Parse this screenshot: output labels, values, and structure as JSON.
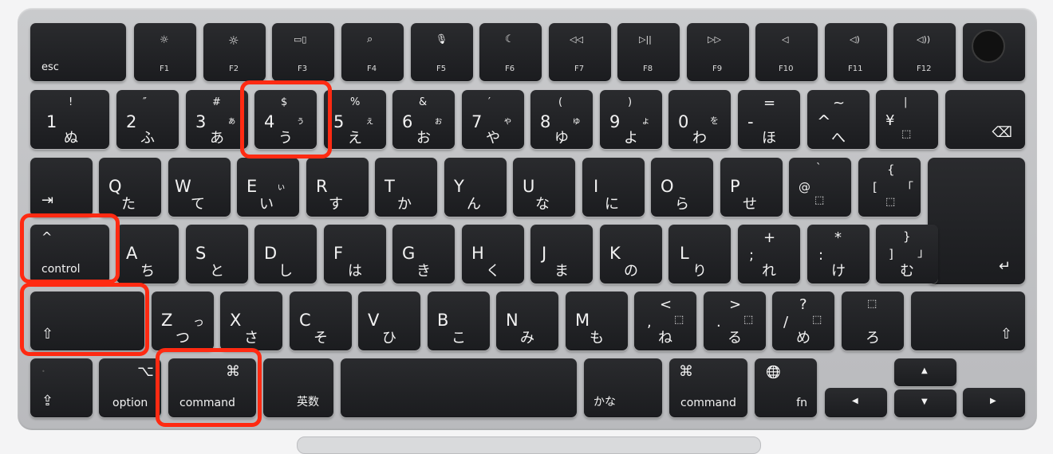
{
  "keyboard": {
    "esc": "esc",
    "brightness_down_icon": "☼",
    "brightness_up_icon": "☼",
    "mission_icon": "▭▯",
    "search_icon": "⌕",
    "mic_icon": "🎙",
    "moon_icon": "☾",
    "rewind_icon": "◁◁",
    "play_icon": "▷||",
    "ffwd_icon": "▷▷",
    "mute_icon": "◁",
    "vol_down_icon": "◁)",
    "vol_up_icon": "◁))",
    "f1": "F1",
    "f2": "F2",
    "f3": "F3",
    "f4": "F4",
    "f5": "F5",
    "f6": "F6",
    "f7": "F7",
    "f8": "F8",
    "f9": "F9",
    "f10": "F10",
    "f11": "F11",
    "f12": "F12",
    "n1": "1",
    "n1s": "!",
    "n1k": "ぬ",
    "n2": "2",
    "n2s": "″",
    "n2k": "ふ",
    "n3": "3",
    "n3s": "#",
    "n3k": "あ",
    "n3ks": "ぁ",
    "n4": "4",
    "n4s": "$",
    "n4k": "う",
    "n4ks": "ぅ",
    "n5": "5",
    "n5s": "%",
    "n5k": "え",
    "n5ks": "ぇ",
    "n6": "6",
    "n6s": "&",
    "n6k": "お",
    "n6ks": "ぉ",
    "n7": "7",
    "n7s": "′",
    "n7k": "や",
    "n7ks": "ゃ",
    "n8": "8",
    "n8s": "(",
    "n8k": "ゆ",
    "n8ks": "ゅ",
    "n9": "9",
    "n9s": ")",
    "n9k": "よ",
    "n9ks": "ょ",
    "n0": "0",
    "n0k": "わ",
    "n0ks": "を",
    "minus": "-",
    "minus_s": "=",
    "minus_k": "ほ",
    "caret": "^",
    "caret_s": "~",
    "caret_k": "へ",
    "yen": "¥",
    "yen_s": "|",
    "yen_k": "⬚",
    "delete_icon": "⌫",
    "tab_icon": "⇥",
    "q": "Q",
    "qk": "た",
    "w": "W",
    "wk": "て",
    "e": "E",
    "ek": "い",
    "eks": "ぃ",
    "r": "R",
    "rk": "す",
    "t": "T",
    "tk": "か",
    "y": "Y",
    "yk": "ん",
    "u": "U",
    "uk": "な",
    "i": "I",
    "ik": "に",
    "o": "O",
    "ok": "ら",
    "p": "P",
    "pk": "せ",
    "at": "@",
    "at_s": "`",
    "at_k": "⬚",
    "lbr": "[",
    "lbr_s": "{",
    "lbr_k": "「",
    "lbr_k2": "⬚",
    "control_icon": "^",
    "control": "control",
    "a": "A",
    "ak": "ち",
    "s": "S",
    "sk": "と",
    "d": "D",
    "dk": "し",
    "f": "F",
    "fk": "は",
    "g": "G",
    "gk": "き",
    "h": "H",
    "hk": "く",
    "j": "J",
    "jk": "ま",
    "k": "K",
    "kk": "の",
    "l": "L",
    "lk": "り",
    "semi": ";",
    "semi_s": "+",
    "semi_k": "れ",
    "colon": ":",
    "colon_s": "*",
    "colon_k": "け",
    "rbr": "]",
    "rbr_s": "}",
    "rbr_k": "む",
    "rbr_k2": "」",
    "return_icon": "↵",
    "shift_icon": "⇧",
    "z": "Z",
    "zk": "つ",
    "zks": "っ",
    "x": "X",
    "xk": "さ",
    "c": "C",
    "ck": "そ",
    "v": "V",
    "vk": "ひ",
    "b": "B",
    "bk": "こ",
    "n": "N",
    "nk": "み",
    "m": "M",
    "mk": "も",
    "comma": ",",
    "comma_s": "<",
    "comma_k": "ね",
    "comma_k2": "⬚",
    "period": ".",
    "period_s": ">",
    "period_k": "る",
    "period_k2": "⬚",
    "slash": "/",
    "slash_s": "?",
    "slash_k": "め",
    "slash_k2": "⬚",
    "ro_k": "ろ",
    "ro_k2": "⬚",
    "caps_icon": "⇪",
    "caps_dot": "•",
    "option_icon": "⌥",
    "option": "option",
    "command_icon": "⌘",
    "command": "command",
    "eisu": "英数",
    "kana": "かな",
    "globe_icon": "🌐",
    "fn": "fn",
    "up_icon": "▲",
    "down_icon": "▼",
    "left_icon": "◀",
    "right_icon": "▶"
  },
  "highlight_color": "#ff2a12"
}
